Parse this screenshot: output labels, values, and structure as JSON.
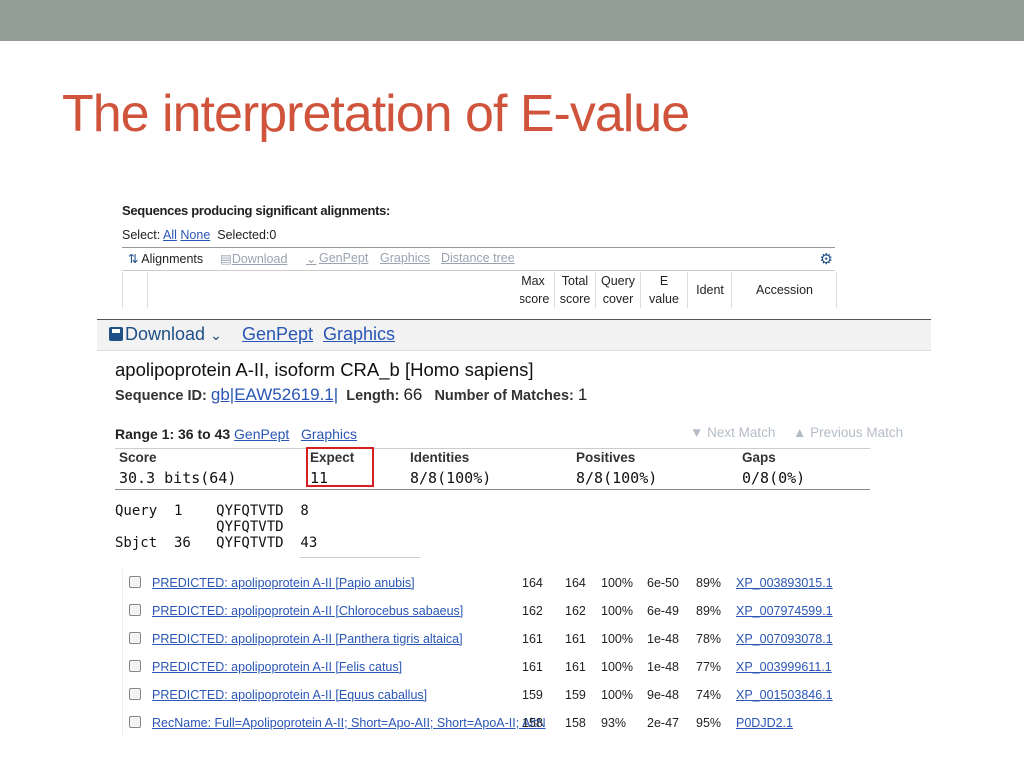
{
  "slide": {
    "title": "The interpretation of E-value"
  },
  "top_table": {
    "heading": "Sequences producing significant alignments:",
    "select_label": "Select:",
    "select_all": "All",
    "select_none": "None",
    "selected": "Selected:0",
    "toolbar": {
      "alignments": "Alignments",
      "download": "Download",
      "genpept": "GenPept",
      "graphics": "Graphics",
      "distance_tree": "Distance tree"
    },
    "columns": [
      {
        "l1": "Max",
        "l2": "score"
      },
      {
        "l1": "Total",
        "l2": "score"
      },
      {
        "l1": "Query",
        "l2": "cover"
      },
      {
        "l1": "E",
        "l2": "value"
      },
      {
        "l1": "Ident",
        "l2": ""
      },
      {
        "l1": "Accession",
        "l2": ""
      }
    ]
  },
  "alignment": {
    "toolbar": {
      "download": "Download",
      "genpept": "GenPept",
      "graphics": "Graphics"
    },
    "protein_name": "apolipoprotein A-II, isoform CRA_b [Homo sapiens]",
    "sequence_id_label": "Sequence ID:",
    "sequence_id": "gb|EAW52619.1|",
    "length_label": "Length:",
    "length": "66",
    "matches_label": "Number of Matches:",
    "matches": "1",
    "range_label": "Range 1: 36 to 43",
    "range_genpept": "GenPept",
    "range_graphics": "Graphics",
    "next_match": "Next Match",
    "previous_match": "Previous Match",
    "score_headers": [
      "Score",
      "Expect",
      "Identities",
      "Positives",
      "Gaps"
    ],
    "score_values": [
      "30.3 bits(64)",
      "11",
      "8/8(100%)",
      "8/8(100%)",
      "0/8(0%)"
    ],
    "query_line": "Query  1    QYFQTVTD  8",
    "match_line": "            QYFQTVTD",
    "sbjct_line": "Sbjct  36   QYFQTVTD  43"
  },
  "results": [
    {
      "desc": "PREDICTED: apolipoprotein A-II [Papio anubis]",
      "max": "164",
      "total": "164",
      "cover": "100%",
      "evalue": "6e-50",
      "ident": "89%",
      "acc": "XP_003893015.1"
    },
    {
      "desc": "PREDICTED: apolipoprotein A-II [Chlorocebus sabaeus]",
      "max": "162",
      "total": "162",
      "cover": "100%",
      "evalue": "6e-49",
      "ident": "89%",
      "acc": "XP_007974599.1"
    },
    {
      "desc": "PREDICTED: apolipoprotein A-II [Panthera tigris altaica]",
      "max": "161",
      "total": "161",
      "cover": "100%",
      "evalue": "1e-48",
      "ident": "78%",
      "acc": "XP_007093078.1"
    },
    {
      "desc": "PREDICTED: apolipoprotein A-II [Felis catus]",
      "max": "161",
      "total": "161",
      "cover": "100%",
      "evalue": "1e-48",
      "ident": "77%",
      "acc": "XP_003999611.1"
    },
    {
      "desc": "PREDICTED: apolipoprotein A-II [Equus caballus]",
      "max": "159",
      "total": "159",
      "cover": "100%",
      "evalue": "9e-48",
      "ident": "74%",
      "acc": "XP_001503846.1"
    },
    {
      "desc": "RecName: Full=Apolipoprotein A-II; Short=Apo-AII; Short=ApoA-II; AltN",
      "max": "158",
      "total": "158",
      "cover": "93%",
      "evalue": "2e-47",
      "ident": "95%",
      "acc": "P0DJD2.1"
    }
  ],
  "colors": {
    "title": "#d0543c",
    "topbar": "#939f96",
    "link": "#2a56b5",
    "highlight_box": "#d42020"
  }
}
